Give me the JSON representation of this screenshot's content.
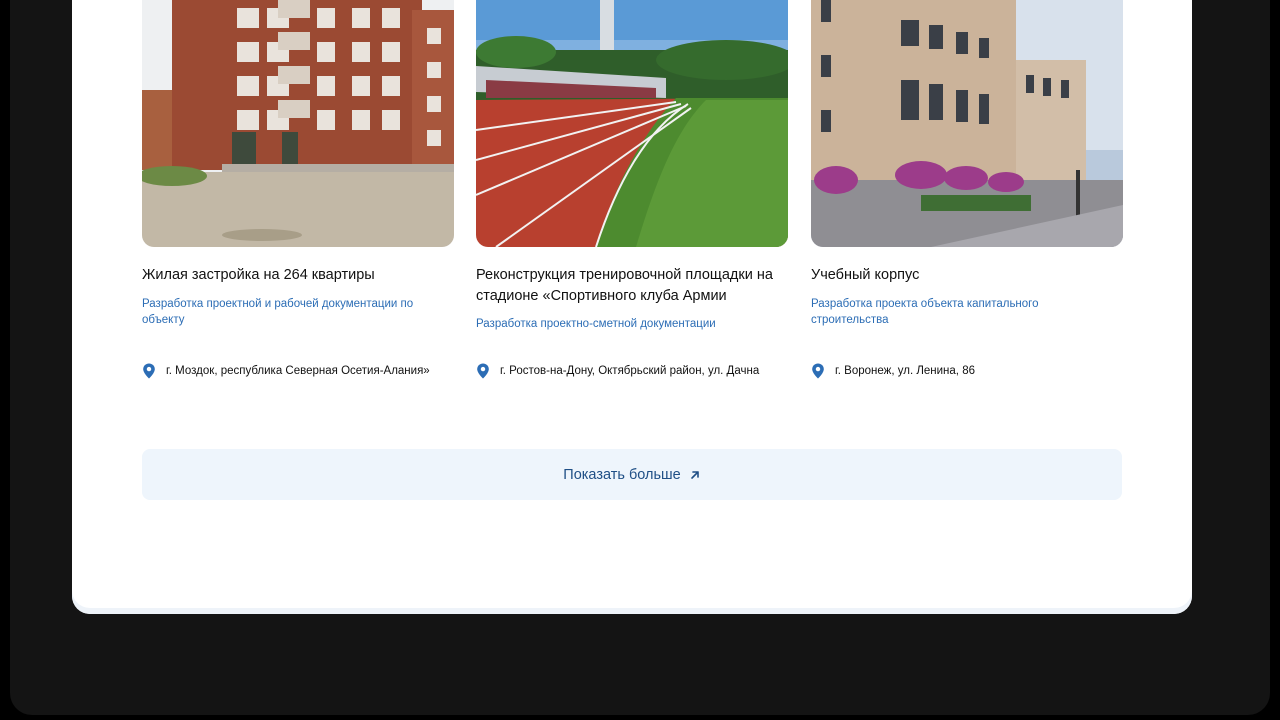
{
  "projects": [
    {
      "title": "Жилая застройка на 264 квартиры",
      "description": "Разработка проектной и рабочей документации по объекту",
      "location": "г. Моздок, республика Северная Осетия-Алания»"
    },
    {
      "title": "Реконструкция тренировочной площадки на стадионе «Спортивного клуба Армии",
      "description": "Разработка проектно-сметной документации",
      "location": "г. Ростов-на-Дону, Октябрьский район, ул. Дачна"
    },
    {
      "title": "Учебный корпус",
      "description": "Разработка проекта объекта капитального строительства",
      "location": "г. Воронеж, ул. Ленина, 86"
    }
  ],
  "show_more": {
    "label": "Показать больше"
  },
  "icons": {
    "location": "map-pin-icon",
    "more": "arrow-up-right-icon"
  },
  "colors": {
    "accent_blue": "#2c6db5",
    "button_bg": "#eef5fc",
    "button_text": "#1f4f86",
    "page_bg": "#141414"
  }
}
